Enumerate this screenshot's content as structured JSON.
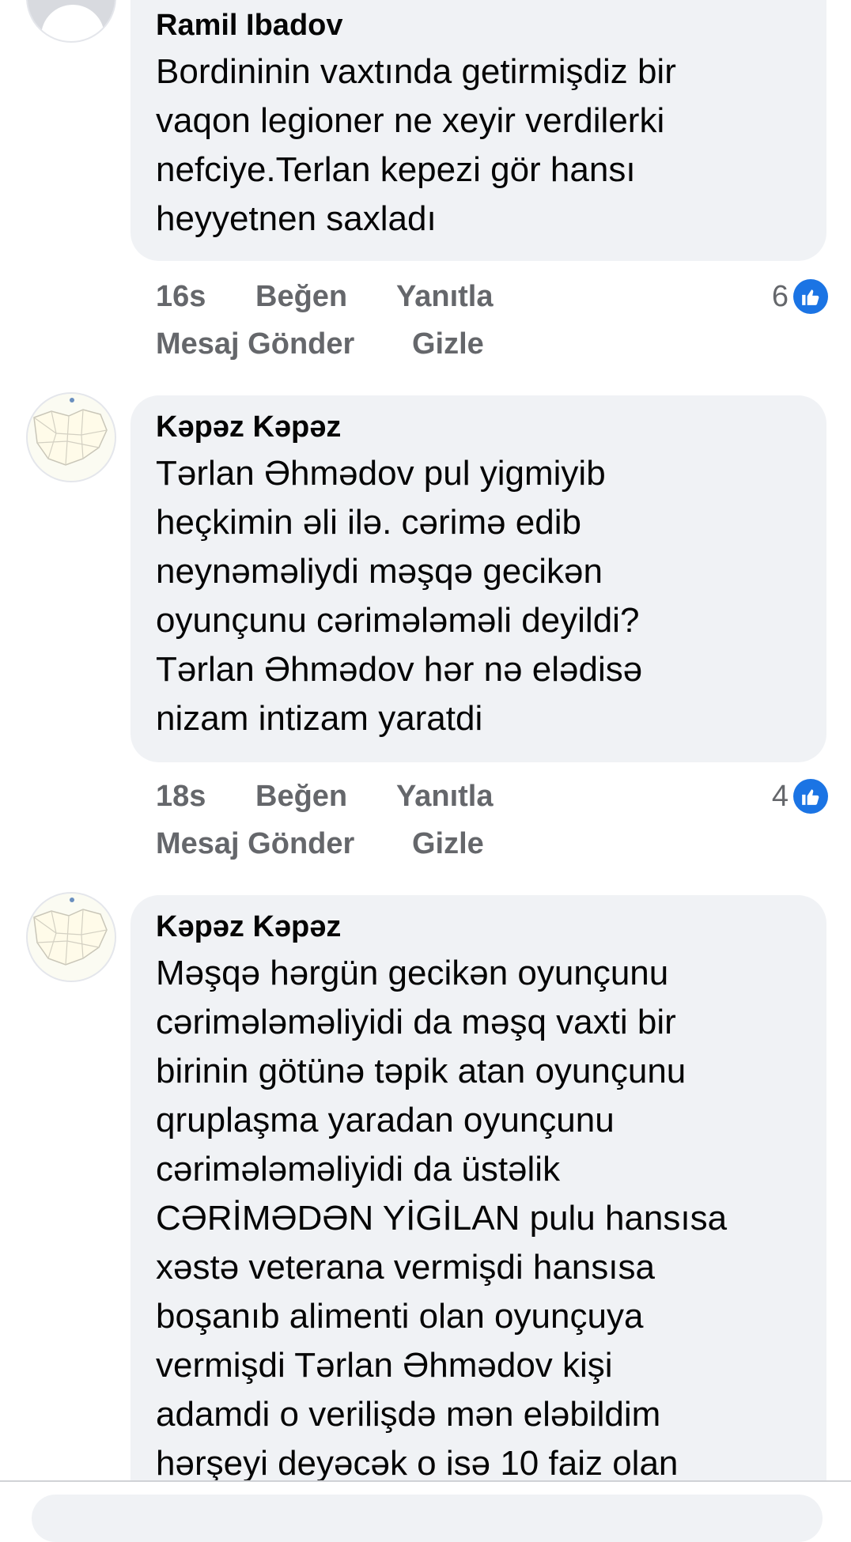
{
  "comments": [
    {
      "author": "Ramil Ibadov",
      "text": "Bordininin vaxtında getirmişdiz bir\nvaqon legioner ne xeyir verdilerki\nnefciye.Terlan kepezi gör hansı\nheyyetnen saxladı",
      "time": "16s",
      "like_label": "Beğen",
      "reply_label": "Yanıtla",
      "message_label": "Mesaj Gönder",
      "hide_label": "Gizle",
      "likes": "6"
    },
    {
      "author": "Kəpəz Kəpəz",
      "text": "Tərlan Əhmədov pul yigmiyib\nheçkimin əli ilə. cərimə edib\nneynəməliydi məşqə gecikən\noyunçunu cərimələməli deyildi?\nTərlan Əhmədov hər nə elədisə\nnizam intizam yaratdi",
      "time": "18s",
      "like_label": "Beğen",
      "reply_label": "Yanıtla",
      "message_label": "Mesaj Gönder",
      "hide_label": "Gizle",
      "likes": "4"
    },
    {
      "author": "Kəpəz Kəpəz",
      "text": "Məşqə hərgün gecikən oyunçunu\ncərimələməliyidi da məşq vaxti bir\nbirinin götünə təpik atan oyunçunu\nqruplaşma yaradan oyunçunu\ncərimələməliyidi da üstəlik\nCƏRİMƏDƏN YİGİLAN pulu hansısa\nxəstə veterana vermişdi hansısa\nboşanıb alimenti olan oyunçuya\nvermişdi Tərlan Əhmədov kişi\nadamdi o verilişdə mən eləbildim\nhərşeyi deyəcək o isə 10 faiz olan"
    }
  ],
  "colors": {
    "bubble": "#f0f2f5",
    "action_text": "#65676b",
    "like_blue": "#1b74e4"
  },
  "icons": {
    "like": "thumbs-up-icon",
    "avatar_default": "default-profile-icon",
    "avatar_map": "map-profile-icon"
  }
}
